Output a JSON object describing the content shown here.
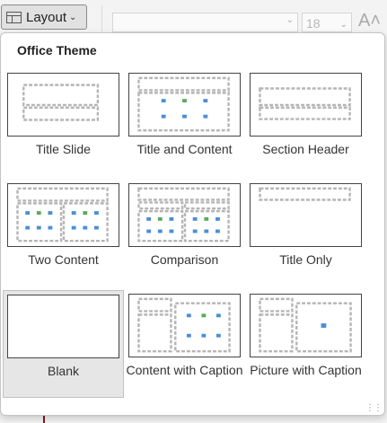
{
  "ribbon": {
    "layout_label": "Layout",
    "font_size_value": "18",
    "grow_font_glyph": "A˄"
  },
  "panel": {
    "title": "Office Theme",
    "selected": "Blank",
    "layouts": [
      {
        "label": "Title Slide"
      },
      {
        "label": "Title and Content"
      },
      {
        "label": "Section Header"
      },
      {
        "label": "Two Content"
      },
      {
        "label": "Comparison"
      },
      {
        "label": "Title Only"
      },
      {
        "label": "Blank"
      },
      {
        "label": "Content with Caption"
      },
      {
        "label": "Picture with Caption"
      }
    ]
  },
  "icons": [
    "layout-icon",
    "chevron-down-icon",
    "grow-font-icon",
    "resize-grip-icon"
  ],
  "colors": {
    "selected_bg": "#e6e6e6",
    "placeholder_dash": "#b5b5b5",
    "icon_blue": "#4a8fd6",
    "icon_green": "#5aaa5a"
  }
}
